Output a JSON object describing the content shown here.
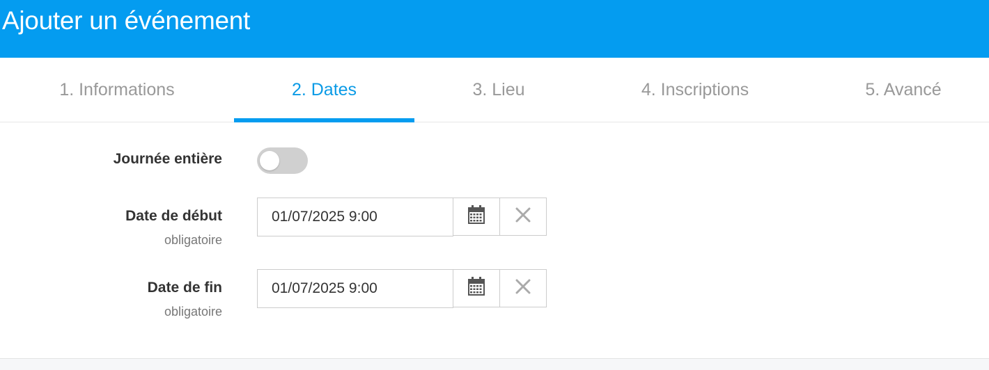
{
  "header": {
    "title": "Ajouter un événement"
  },
  "tabs": [
    {
      "label": "1. Informations",
      "active": false
    },
    {
      "label": "2. Dates",
      "active": true
    },
    {
      "label": "3. Lieu",
      "active": false
    },
    {
      "label": "4. Inscriptions",
      "active": false
    },
    {
      "label": "5. Avancé",
      "active": false
    }
  ],
  "form": {
    "all_day": {
      "label": "Journée entière",
      "checked": false
    },
    "start": {
      "label": "Date de début",
      "hint": "obligatoire",
      "value": "01/07/2025 9:00",
      "calendar_icon": "calendar-icon",
      "clear_icon": "close-icon"
    },
    "end": {
      "label": "Date de fin",
      "hint": "obligatoire",
      "value": "01/07/2025 9:00",
      "calendar_icon": "calendar-icon",
      "clear_icon": "close-icon"
    }
  },
  "colors": {
    "header": "#049cf0",
    "active_tab": "#0b9be6",
    "inactive_tab": "#999999",
    "toggle_off": "#d0d0d0"
  }
}
